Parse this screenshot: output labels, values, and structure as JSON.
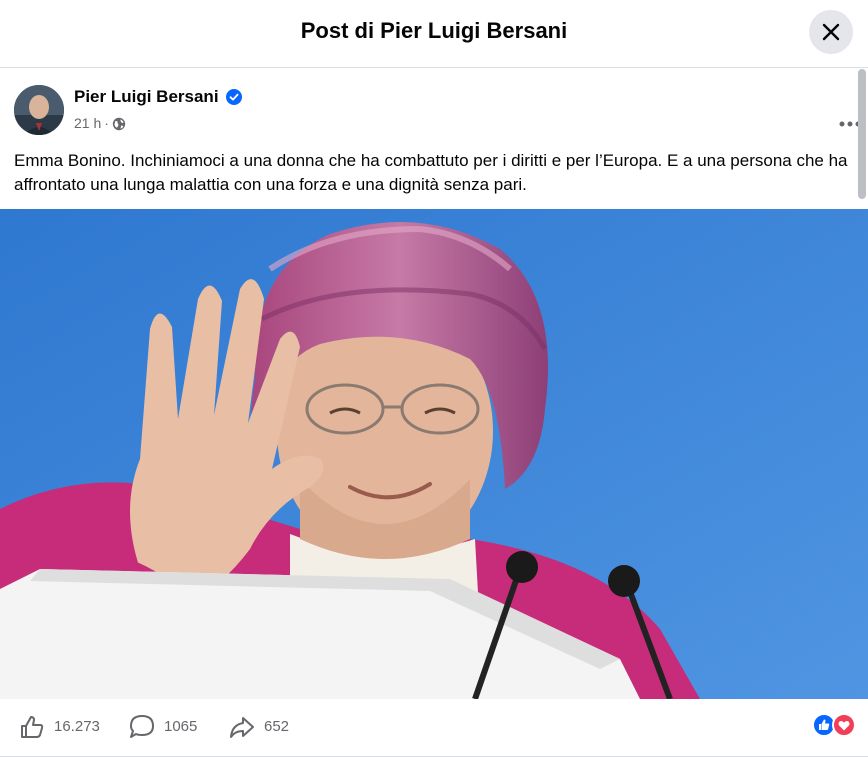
{
  "dialog": {
    "title": "Post di Pier Luigi Bersani",
    "close_icon": "close-icon"
  },
  "post": {
    "author": "Pier Luigi Bersani",
    "verified": true,
    "time": "21 h",
    "separator": "·",
    "audience_icon": "globe-icon",
    "text": "Emma Bonino. Inchiniamoci a una donna che ha combattuto per i diritti e per l’Europa. E a una persona che ha affrontato una lunga malattia con una forza e una dignità senza pari.",
    "image_alt": "Photo of an elderly woman in a purple headscarf and glasses waving at a podium with microphones"
  },
  "stats": {
    "likes": "16.273",
    "comments": "1065",
    "shares": "652",
    "reactions": [
      "like",
      "love"
    ]
  },
  "colors": {
    "accent": "#0866ff",
    "love": "#f33e58",
    "muted": "#65676b"
  }
}
